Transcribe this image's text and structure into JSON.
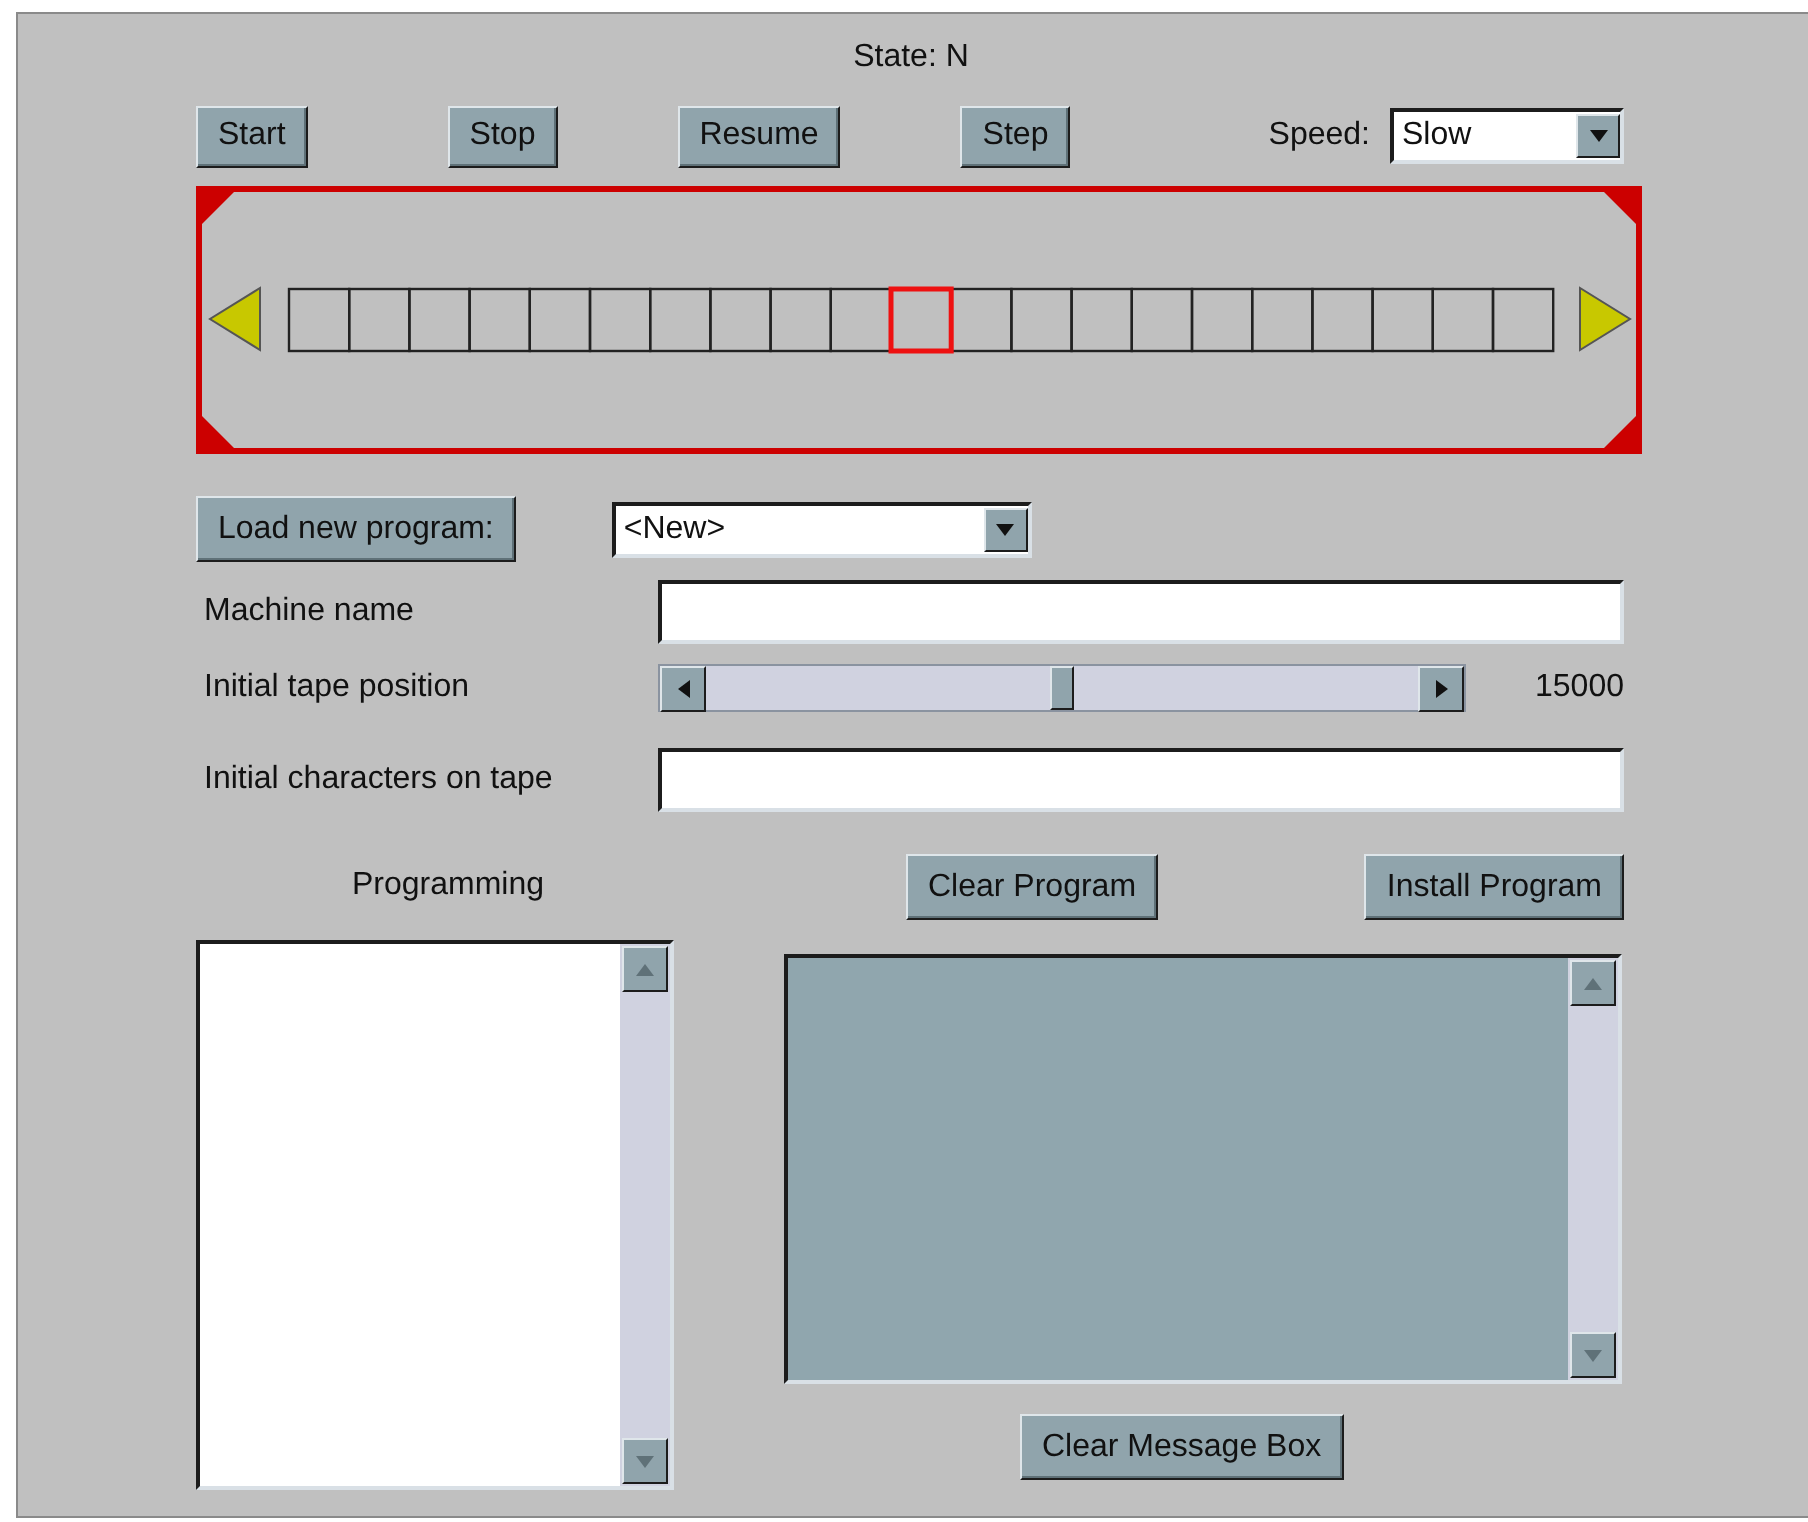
{
  "state_label": "State: N",
  "controls": [
    {
      "label": "Start"
    },
    {
      "label": "Stop"
    },
    {
      "label": "Resume"
    },
    {
      "label": "Step"
    }
  ],
  "speed": {
    "label": "Speed:",
    "value": "Slow"
  },
  "tape": {
    "cells": [
      {
        "selected": false
      },
      {
        "selected": false
      },
      {
        "selected": false
      },
      {
        "selected": false
      },
      {
        "selected": false
      },
      {
        "selected": false
      },
      {
        "selected": false
      },
      {
        "selected": false
      },
      {
        "selected": false
      },
      {
        "selected": false
      },
      {
        "selected": true
      },
      {
        "selected": false
      },
      {
        "selected": false
      },
      {
        "selected": false
      },
      {
        "selected": false
      },
      {
        "selected": false
      },
      {
        "selected": false
      },
      {
        "selected": false
      },
      {
        "selected": false
      },
      {
        "selected": false
      },
      {
        "selected": false
      }
    ]
  },
  "load": {
    "button": "Load new program:",
    "value": "<New>"
  },
  "machine_name": {
    "label": "Machine name"
  },
  "tape_position": {
    "label": "Initial tape position",
    "level": 0.5,
    "reading": "15000"
  },
  "initial_chars": {
    "label": "Initial characters on tape"
  },
  "programming": {
    "label": "Programming"
  },
  "program_buttons": [
    {
      "label": "Clear Program"
    },
    {
      "label": "Install Program"
    }
  ],
  "message_box": {
    "button": "Clear Message Box"
  }
}
